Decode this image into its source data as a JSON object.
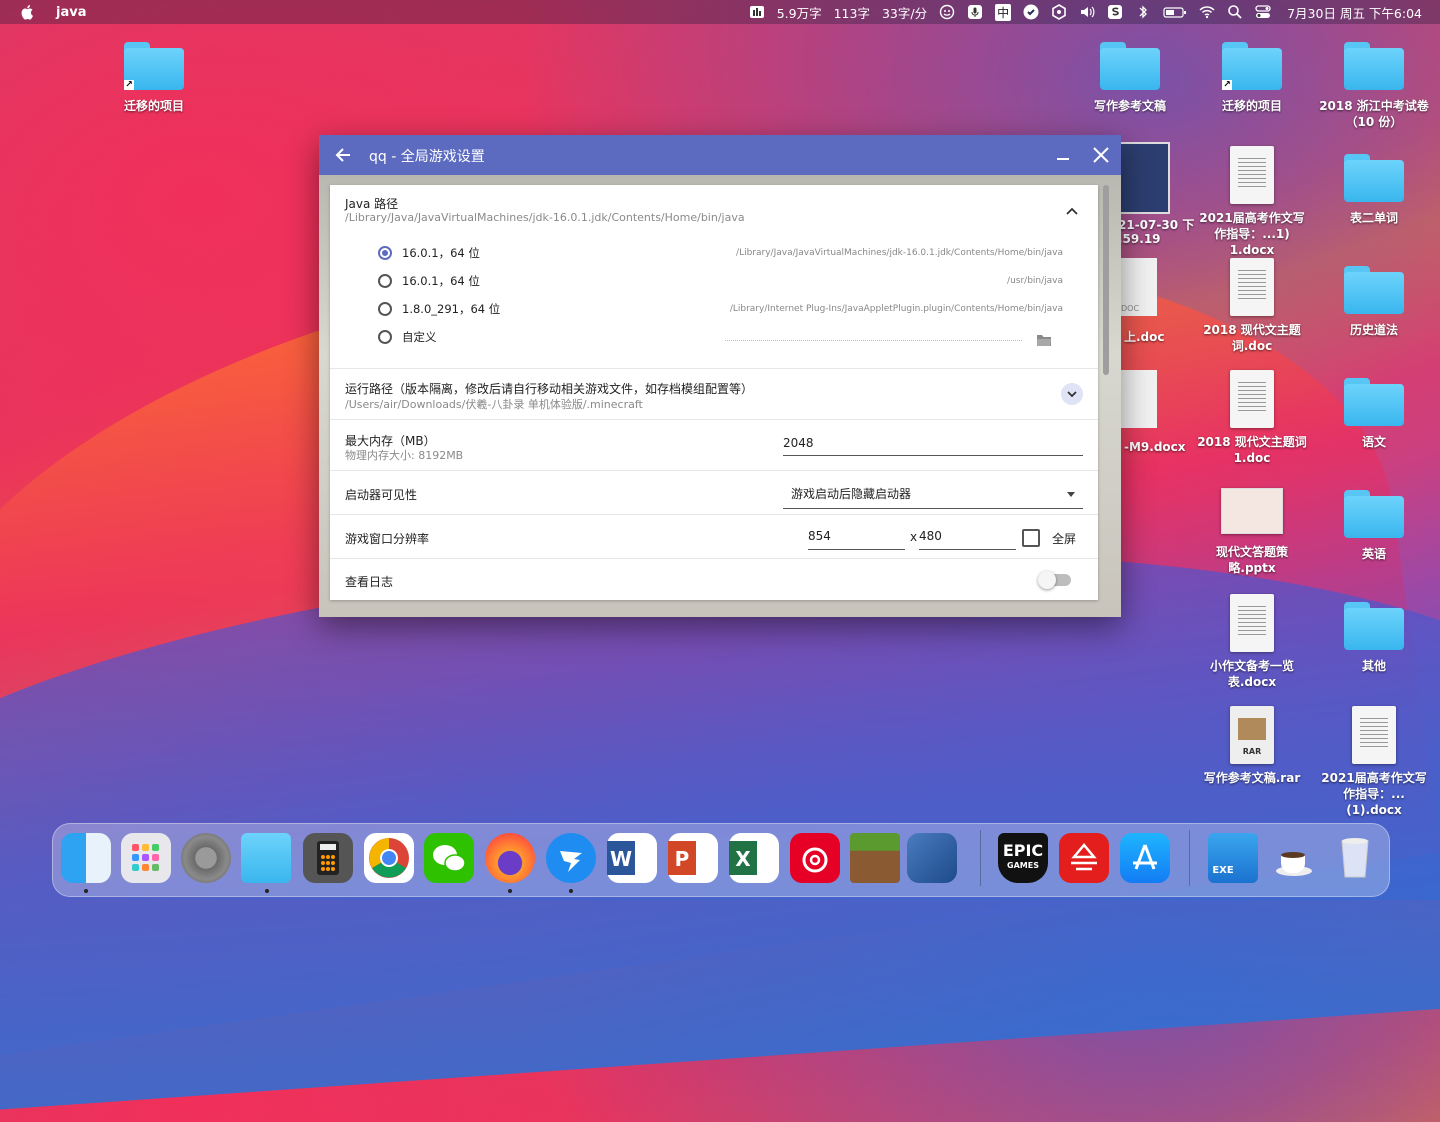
{
  "menubar": {
    "app_name": "java",
    "stats": "5.9万字",
    "words_today": "113字",
    "speed": "33字/分",
    "ime": "中",
    "datetime": "7月30日 周五 下午6:04"
  },
  "desktop": {
    "left_icons": [
      {
        "label": "迁移的项目",
        "kind": "folder-alias"
      }
    ],
    "right_icons": [
      {
        "label": "写作参考文稿",
        "kind": "folder"
      },
      {
        "label": "迁移的项目",
        "kind": "folder-alias"
      },
      {
        "label": "2018 浙江中考试卷（10 份）",
        "kind": "folder"
      },
      {
        "label": "2021届高考作文写作指导：...1) 1.docx",
        "kind": "doc"
      },
      {
        "label": "表二单词",
        "kind": "folder"
      },
      {
        "label": "2018 现代文主题词.doc",
        "kind": "doc"
      },
      {
        "label": "历史道法",
        "kind": "folder"
      },
      {
        "label": "2018 现代文主题词 1.doc",
        "kind": "doc"
      },
      {
        "label": "语文",
        "kind": "folder"
      },
      {
        "label": "现代文答题策略.pptx",
        "kind": "ppt"
      },
      {
        "label": "英语",
        "kind": "folder"
      },
      {
        "label": "小作文备考一览表.docx",
        "kind": "doc"
      },
      {
        "label": "其他",
        "kind": "folder"
      },
      {
        "label": "写作参考文稿.rar",
        "kind": "rar"
      },
      {
        "label": "2021届高考作文写作指导：...(1).docx",
        "kind": "doc"
      }
    ],
    "peek_labels": {
      "screenshot_a": "21-07-30 下",
      "screenshot_b": ".59.19",
      "doc_a": "上.doc",
      "doc_b": "-M9.docx",
      "doc_ext": "DOC"
    }
  },
  "window": {
    "title": "qq - 全局游戏设置",
    "java": {
      "title": "Java 路径",
      "current": "/Library/Java/JavaVirtualMachines/jdk-16.0.1.jdk/Contents/Home/bin/java",
      "options": [
        {
          "label": "16.0.1，64 位",
          "path": "/Library/Java/JavaVirtualMachines/jdk-16.0.1.jdk/Contents/Home/bin/java",
          "selected": true
        },
        {
          "label": "16.0.1，64 位",
          "path": "/usr/bin/java",
          "selected": false
        },
        {
          "label": "1.8.0_291，64 位",
          "path": "/Library/Internet Plug-Ins/JavaAppletPlugin.plugin/Contents/Home/bin/java",
          "selected": false
        },
        {
          "label": "自定义",
          "path": "",
          "selected": false
        }
      ]
    },
    "run_path": {
      "title": "运行路径（版本隔离，修改后请自行移动相关游戏文件，如存档模组配置等）",
      "value": "/Users/air/Downloads/伏羲-八卦录 单机体验版/.minecraft"
    },
    "memory": {
      "title": "最大内存（MB）",
      "sub": "物理内存大小: 8192MB",
      "value": "2048"
    },
    "visibility": {
      "title": "启动器可见性",
      "value": "游戏启动后隐藏启动器"
    },
    "resolution": {
      "title": "游戏窗口分辨率",
      "width": "854",
      "x": "x",
      "height": "480",
      "fullscreen_label": "全屏",
      "fullscreen": false
    },
    "log": {
      "title": "查看日志",
      "enabled": false
    }
  },
  "dock": {
    "apps": [
      "Finder",
      "Launchpad",
      "System Preferences",
      "Folder",
      "Calculator",
      "Chrome",
      "WeChat",
      "Firefox",
      "DingTalk",
      "Word",
      "PowerPoint",
      "Excel",
      "NetEase Music",
      "Minecraft",
      "VirtualBox",
      "Epic Games",
      "Huawei",
      "App Store",
      "EXE",
      "Java",
      "Trash"
    ],
    "epic_line1": "EPIC",
    "epic_line2": "GAMES",
    "exe_label": "EXE"
  },
  "colors": {
    "accent": "#5c6bc0",
    "window_bg": "#ffffff"
  }
}
